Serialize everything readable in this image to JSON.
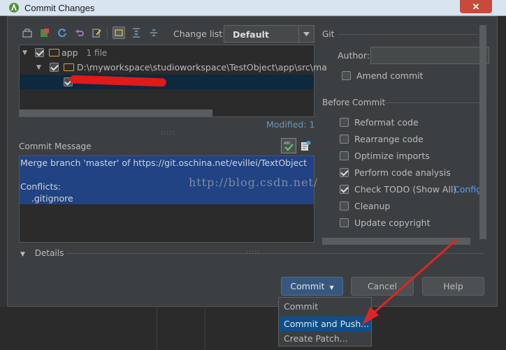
{
  "window": {
    "title": "Commit Changes",
    "close_glyph": "✕"
  },
  "toolbar": {
    "change_list_label": "Change list:",
    "change_list_value": "Default",
    "icons": [
      "show-diff-icon",
      "move-to-changelist-icon",
      "refresh-icon",
      "rollback-icon",
      "edit-source-icon",
      "group-by-directory-icon",
      "expand-all-icon",
      "collapse-all-icon"
    ]
  },
  "tree": {
    "root": {
      "label": "app",
      "count": "1 file"
    },
    "path": {
      "label": "D:\\myworkspace\\studioworkspace\\TestObject\\app\\src\\ma"
    },
    "file": {
      "label": ""
    }
  },
  "modified_label": "Modified: 1",
  "commit_message": {
    "label": "Commit Message",
    "lines": [
      "Merge branch 'master' of https://git.oschina.net/evillei/TextObject",
      "",
      "Conflicts:",
      "    .gitignore"
    ]
  },
  "watermark": "http://blog.csdn.net/",
  "details_label": "Details",
  "git": {
    "section_label": "Git",
    "author_label": "Author:",
    "author_value": "",
    "amend_label": "Amend commit"
  },
  "before_commit": {
    "section_label": "Before Commit",
    "options": [
      {
        "label": "Reformat code",
        "checked": false
      },
      {
        "label": "Rearrange code",
        "checked": false
      },
      {
        "label": "Optimize imports",
        "checked": false
      },
      {
        "label": "Perform code analysis",
        "checked": true
      },
      {
        "label": "Check TODO (Show All)",
        "checked": true
      },
      {
        "label": "Cleanup",
        "checked": false
      },
      {
        "label": "Update copyright",
        "checked": false
      }
    ],
    "configure_link": "Configu"
  },
  "buttons": {
    "commit": "Commit",
    "cancel": "Cancel",
    "help": "Help"
  },
  "commit_menu": {
    "items": [
      "Commit",
      "Commit and Push...",
      "Create Patch..."
    ],
    "highlighted_index": 1
  },
  "colors": {
    "accent": "#365880",
    "selection": "#214283",
    "highlight": "#0d4f8c",
    "link": "#589df6",
    "annotation_arrow": "#e02424"
  }
}
